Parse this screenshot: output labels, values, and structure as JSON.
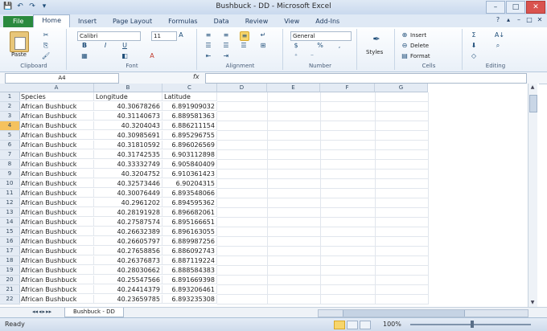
{
  "window": {
    "title": "Bushbuck - DD - Microsoft Excel",
    "controls": [
      "–",
      "□",
      "✕"
    ]
  },
  "qat": [
    "💾",
    "↶",
    "↷",
    "▾"
  ],
  "tabs": [
    {
      "label": "File"
    },
    {
      "label": "Home"
    },
    {
      "label": "Insert"
    },
    {
      "label": "Page Layout"
    },
    {
      "label": "Formulas"
    },
    {
      "label": "Data"
    },
    {
      "label": "Review"
    },
    {
      "label": "View"
    },
    {
      "label": "Add-Ins"
    }
  ],
  "ribbon": {
    "clipboard": {
      "paste_label": "Paste",
      "group_label": "Clipboard"
    },
    "font": {
      "font_name": "Calibri",
      "font_size": "11",
      "bold": "B",
      "italic": "I",
      "underline": "U",
      "group_label": "Font"
    },
    "alignment": {
      "group_label": "Alignment"
    },
    "number": {
      "format": "General",
      "currency": "$",
      "percent": "%",
      "comma": ",",
      "group_label": "Number"
    },
    "styles": {
      "label": "Styles"
    },
    "cells": {
      "insert": "Insert",
      "delete": "Delete",
      "format": "Format",
      "group_label": "Cells"
    },
    "editing": {
      "group_label": "Editing",
      "sum": "Σ",
      "sort": "A↓"
    }
  },
  "formula_bar": {
    "name_box": "A4",
    "fx": "fx",
    "content": ""
  },
  "grid": {
    "columns": [
      "A",
      "B",
      "C",
      "D",
      "E",
      "F",
      "G"
    ],
    "rows": [
      {
        "n": "1",
        "a": "Species",
        "b": "Longitude",
        "c": "Latitude"
      },
      {
        "n": "2",
        "a": "African Bushbuck",
        "b": "40.30678266",
        "c": "6.891909032"
      },
      {
        "n": "3",
        "a": "African Bushbuck",
        "b": "40.31140673",
        "c": "6.889581363"
      },
      {
        "n": "4",
        "a": "African Bushbuck",
        "b": "40.3204043",
        "c": "6.886211154"
      },
      {
        "n": "5",
        "a": "African Bushbuck",
        "b": "40.30985691",
        "c": "6.895296755"
      },
      {
        "n": "6",
        "a": "African Bushbuck",
        "b": "40.31810592",
        "c": "6.896026569"
      },
      {
        "n": "7",
        "a": "African Bushbuck",
        "b": "40.31742535",
        "c": "6.903112898"
      },
      {
        "n": "8",
        "a": "African Bushbuck",
        "b": "40.33332749",
        "c": "6.905840409"
      },
      {
        "n": "9",
        "a": "African Bushbuck",
        "b": "40.3204752",
        "c": "6.910361423"
      },
      {
        "n": "10",
        "a": "African Bushbuck",
        "b": "40.32573446",
        "c": "6.90204315"
      },
      {
        "n": "11",
        "a": "African Bushbuck",
        "b": "40.30076449",
        "c": "6.893548066"
      },
      {
        "n": "12",
        "a": "African Bushbuck",
        "b": "40.2961202",
        "c": "6.894595362"
      },
      {
        "n": "13",
        "a": "African Bushbuck",
        "b": "40.28191928",
        "c": "6.896682061"
      },
      {
        "n": "14",
        "a": "African Bushbuck",
        "b": "40.27587574",
        "c": "6.895166651"
      },
      {
        "n": "15",
        "a": "African Bushbuck",
        "b": "40.26632389",
        "c": "6.896163055"
      },
      {
        "n": "16",
        "a": "African Bushbuck",
        "b": "40.26605797",
        "c": "6.889987256"
      },
      {
        "n": "17",
        "a": "African Bushbuck",
        "b": "40.27658856",
        "c": "6.886092743"
      },
      {
        "n": "18",
        "a": "African Bushbuck",
        "b": "40.26376873",
        "c": "6.887119224"
      },
      {
        "n": "19",
        "a": "African Bushbuck",
        "b": "40.28030662",
        "c": "6.888584383"
      },
      {
        "n": "20",
        "a": "African Bushbuck",
        "b": "40.25547566",
        "c": "6.891669398"
      },
      {
        "n": "21",
        "a": "African Bushbuck",
        "b": "40.24414379",
        "c": "6.893206461"
      },
      {
        "n": "22",
        "a": "African Bushbuck",
        "b": "40.23659785",
        "c": "6.893235308"
      }
    ]
  },
  "sheet": {
    "tab": "Bushbuck - DD",
    "nav": [
      "◂◂",
      "◂",
      "▸",
      "▸▸"
    ]
  },
  "status": {
    "ready": "Ready",
    "zoom": "100%",
    "minus": "−",
    "plus": "+"
  }
}
